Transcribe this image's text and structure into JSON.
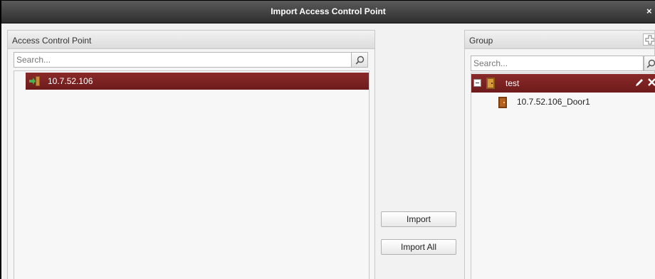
{
  "window": {
    "title": "Import Access Control Point",
    "close_glyph": "×"
  },
  "left_panel": {
    "header": "Access Control Point",
    "search_placeholder": "Search...",
    "items": [
      {
        "label": "10.7.52.106",
        "icon": "device-import-icon",
        "selected": true
      }
    ]
  },
  "actions": {
    "import_label": "Import",
    "import_all_label": "Import All"
  },
  "right_panel": {
    "header": "Group",
    "search_placeholder": "Search...",
    "group": {
      "label": "test",
      "icon": "group-door-icon",
      "selected": true,
      "expanded": true
    },
    "children": [
      {
        "label": "10.7.52.106_Door1",
        "icon": "door-icon"
      }
    ]
  },
  "colors": {
    "selection": "#7a2020",
    "title_bar": "#3a3a3a",
    "icon_accent": "#8b5a1e"
  }
}
